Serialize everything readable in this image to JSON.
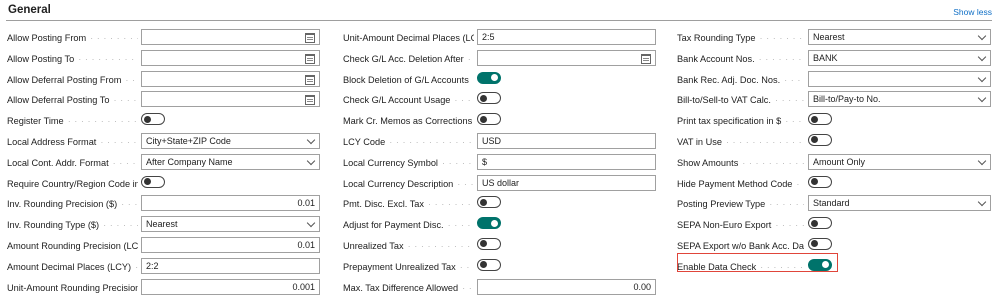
{
  "header": {
    "title": "General",
    "show_less": "Show less"
  },
  "col1": [
    {
      "label": "Allow Posting From",
      "type": "date",
      "value": ""
    },
    {
      "label": "Allow Posting To",
      "type": "date",
      "value": ""
    },
    {
      "label": "Allow Deferral Posting From",
      "type": "date",
      "value": ""
    },
    {
      "label": "Allow Deferral Posting To",
      "type": "date",
      "value": ""
    },
    {
      "label": "Register Time",
      "type": "toggle",
      "on": false
    },
    {
      "label": "Local Address Format",
      "type": "select",
      "value": "City+State+ZIP Code"
    },
    {
      "label": "Local Cont. Addr. Format",
      "type": "select",
      "value": "After Company Name"
    },
    {
      "label": "Require Country/Region Code in ...",
      "type": "toggle",
      "on": false
    },
    {
      "label": "Inv. Rounding Precision ($)",
      "type": "number",
      "value": "0.01"
    },
    {
      "label": "Inv. Rounding Type ($)",
      "type": "select",
      "value": "Nearest"
    },
    {
      "label": "Amount Rounding Precision (LCY)",
      "type": "number",
      "value": "0.01"
    },
    {
      "label": "Amount Decimal Places (LCY)",
      "type": "text",
      "value": "2:2"
    },
    {
      "label": "Unit-Amount Rounding Precision (...",
      "type": "number",
      "value": "0.001"
    }
  ],
  "col2": [
    {
      "label": "Unit-Amount Decimal Places (LCY)",
      "type": "text",
      "value": "2:5"
    },
    {
      "label": "Check G/L Acc. Deletion After",
      "type": "date",
      "value": ""
    },
    {
      "label": "Block Deletion of G/L Accounts",
      "type": "toggle",
      "on": true
    },
    {
      "label": "Check G/L Account Usage",
      "type": "toggle",
      "on": false
    },
    {
      "label": "Mark Cr. Memos as Corrections",
      "type": "toggle",
      "on": false
    },
    {
      "label": "LCY Code",
      "type": "text",
      "value": "USD"
    },
    {
      "label": "Local Currency Symbol",
      "type": "text",
      "value": "$"
    },
    {
      "label": "Local Currency Description",
      "type": "text",
      "value": "US dollar"
    },
    {
      "label": "Pmt. Disc. Excl. Tax",
      "type": "toggle",
      "on": false
    },
    {
      "label": "Adjust for Payment Disc.",
      "type": "toggle",
      "on": true
    },
    {
      "label": "Unrealized Tax",
      "type": "toggle",
      "on": false
    },
    {
      "label": "Prepayment Unrealized Tax",
      "type": "toggle",
      "on": false
    },
    {
      "label": "Max. Tax Difference Allowed",
      "type": "number",
      "value": "0.00"
    }
  ],
  "col3": [
    {
      "label": "Tax Rounding Type",
      "type": "select",
      "value": "Nearest"
    },
    {
      "label": "Bank Account Nos.",
      "type": "select",
      "value": "BANK"
    },
    {
      "label": "Bank Rec. Adj. Doc. Nos.",
      "type": "select",
      "value": ""
    },
    {
      "label": "Bill-to/Sell-to VAT Calc.",
      "type": "select",
      "value": "Bill-to/Pay-to No."
    },
    {
      "label": "Print tax specification in $",
      "type": "toggle",
      "on": false
    },
    {
      "label": "VAT in Use",
      "type": "toggle",
      "on": false
    },
    {
      "label": "Show Amounts",
      "type": "select",
      "value": "Amount Only"
    },
    {
      "label": "Hide Payment Method Code",
      "type": "toggle",
      "on": false
    },
    {
      "label": "Posting Preview Type",
      "type": "select",
      "value": "Standard"
    },
    {
      "label": "SEPA Non-Euro Export",
      "type": "toggle",
      "on": false
    },
    {
      "label": "SEPA Export w/o Bank Acc. Data",
      "type": "toggle",
      "on": false
    },
    {
      "label": "Enable Data Check",
      "type": "toggle",
      "on": true,
      "highlighted": true
    }
  ],
  "colors": {
    "accent": "#00736b",
    "highlight": "#e0453a",
    "link": "#0f6fc6"
  }
}
